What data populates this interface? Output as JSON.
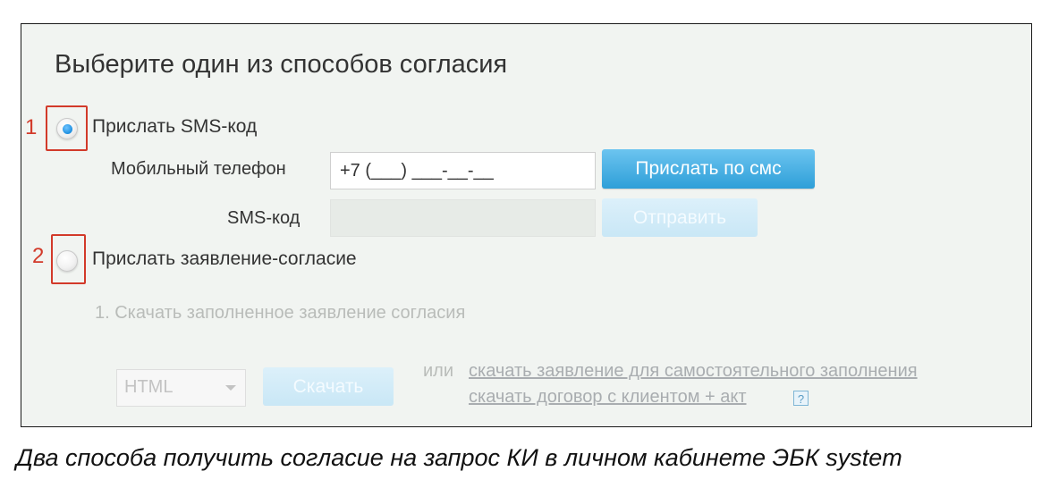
{
  "panel": {
    "title": "Выберите один из способов согласия"
  },
  "option_sms": {
    "marker": "1",
    "label": "Прислать SMS-код",
    "selected": true,
    "phone_label": "Мобильный телефон",
    "phone_value": "+7 (___) ___-__-__",
    "send_sms_button": "Прислать по смс",
    "code_label": "SMS-код",
    "code_value": "",
    "submit_button": "Отправить"
  },
  "option_statement": {
    "marker": "2",
    "label": "Прислать заявление-согласие",
    "selected": false,
    "step1": "1. Скачать заполненное заявление согласия",
    "format_selected": "HTML",
    "download_button": "Скачать",
    "or_text": "или",
    "link_self_fill": "скачать заявление для самостоятельного заполнения",
    "link_contract": "скачать договор с клиентом + акт",
    "help_glyph": "?"
  },
  "caption": "Два способа получить согласие на запрос КИ в личном кабинете ЭБК system",
  "colors": {
    "accent": "#2e9fd8",
    "marker": "#d23a2a",
    "panel_bg": "#f1f4f1"
  }
}
